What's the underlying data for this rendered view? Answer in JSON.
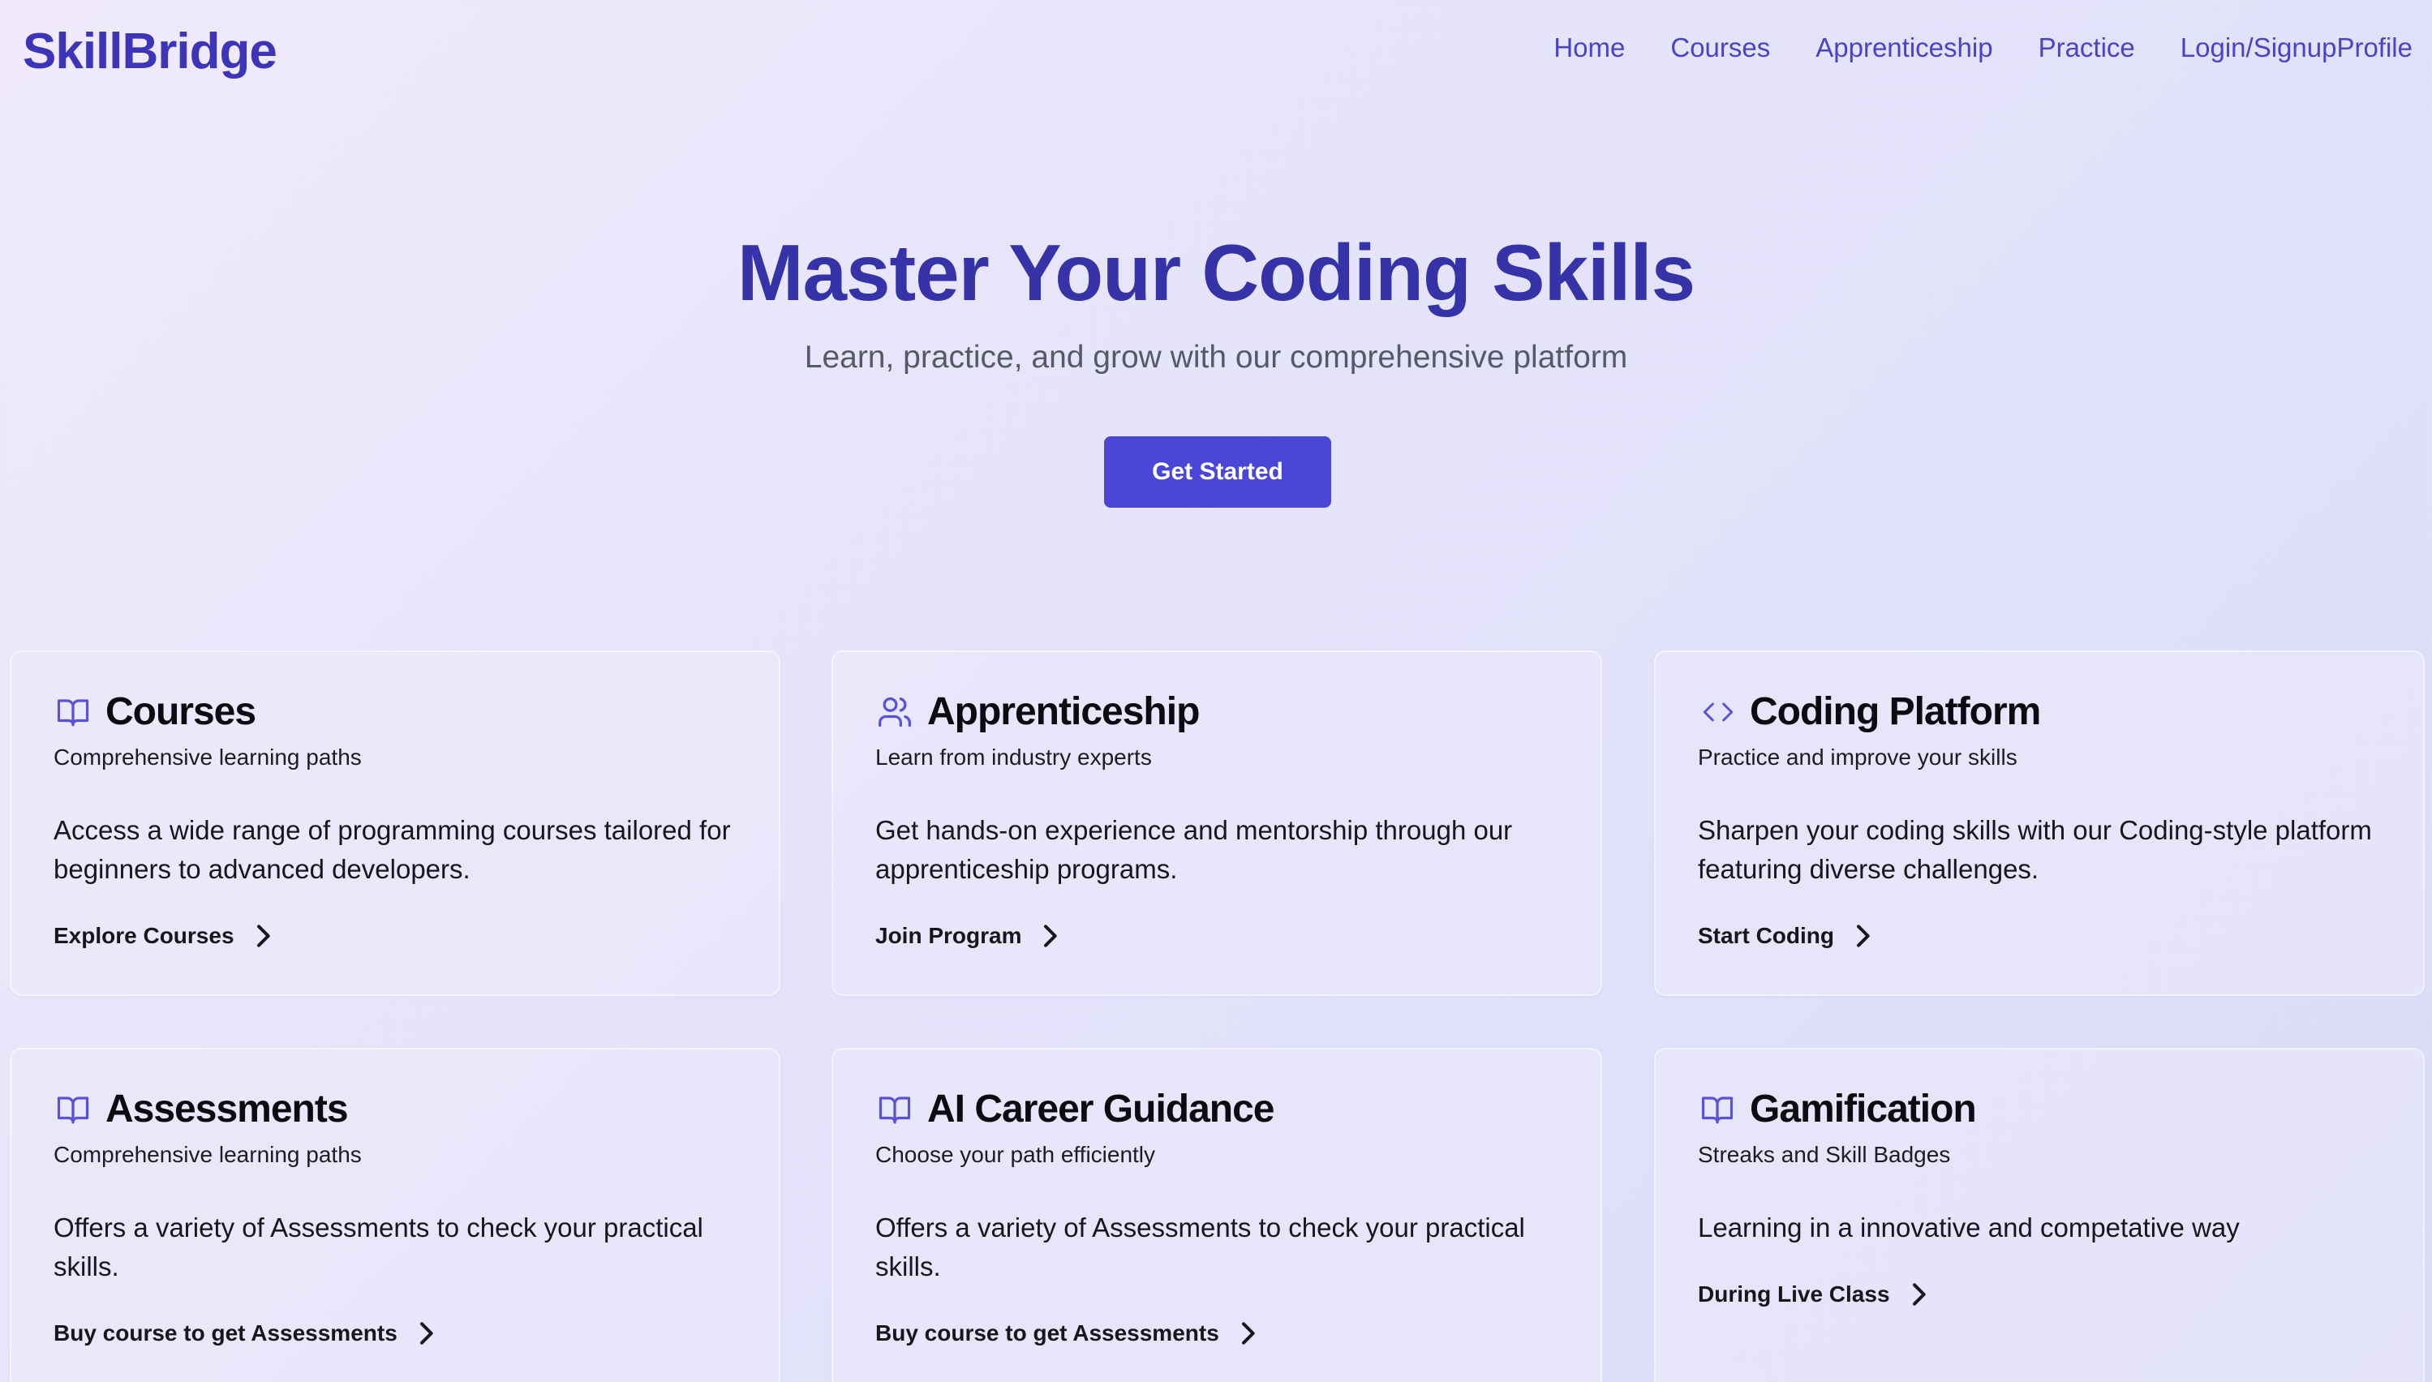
{
  "brand": "SkillBridge",
  "nav": {
    "home": "Home",
    "courses": "Courses",
    "apprenticeship": "Apprenticeship",
    "practice": "Practice",
    "login": "Login/Signup",
    "profile": "Profile"
  },
  "hero": {
    "title": "Master Your Coding Skills",
    "subtitle": "Learn, practice, and grow with our comprehensive platform",
    "cta": "Get Started"
  },
  "cards": [
    {
      "icon": "book-open-icon",
      "title": "Courses",
      "subtitle": "Comprehensive learning paths",
      "description": "Access a wide range of programming courses tailored for beginners to advanced developers.",
      "link": "Explore Courses"
    },
    {
      "icon": "users-icon",
      "title": "Apprenticeship",
      "subtitle": "Learn from industry experts",
      "description": "Get hands-on experience and mentorship through our apprenticeship programs.",
      "link": "Join Program"
    },
    {
      "icon": "code-icon",
      "title": "Coding Platform",
      "subtitle": "Practice and improve your skills",
      "description": "Sharpen your coding skills with our Coding-style platform featuring diverse challenges.",
      "link": "Start Coding"
    },
    {
      "icon": "book-open-icon",
      "title": "Assessments",
      "subtitle": "Comprehensive learning paths",
      "description": "Offers a variety of Assessments to check your practical skills.",
      "link": "Buy course to get Assessments"
    },
    {
      "icon": "book-open-icon",
      "title": "AI Career Guidance",
      "subtitle": "Choose your path efficiently",
      "description": "Offers a variety of Assessments to check your practical skills.",
      "link": "Buy course to get Assessments"
    },
    {
      "icon": "book-open-icon",
      "title": "Gamification",
      "subtitle": "Streaks and Skill Badges",
      "description": "Learning in a innovative and competative way",
      "link": "During Live Class"
    }
  ],
  "colors": {
    "brand": "#3d35b8",
    "nav_link": "#4a43c6",
    "hero_title": "#3632a8",
    "button": "#4b47d6",
    "icon": "#5a52d6"
  }
}
